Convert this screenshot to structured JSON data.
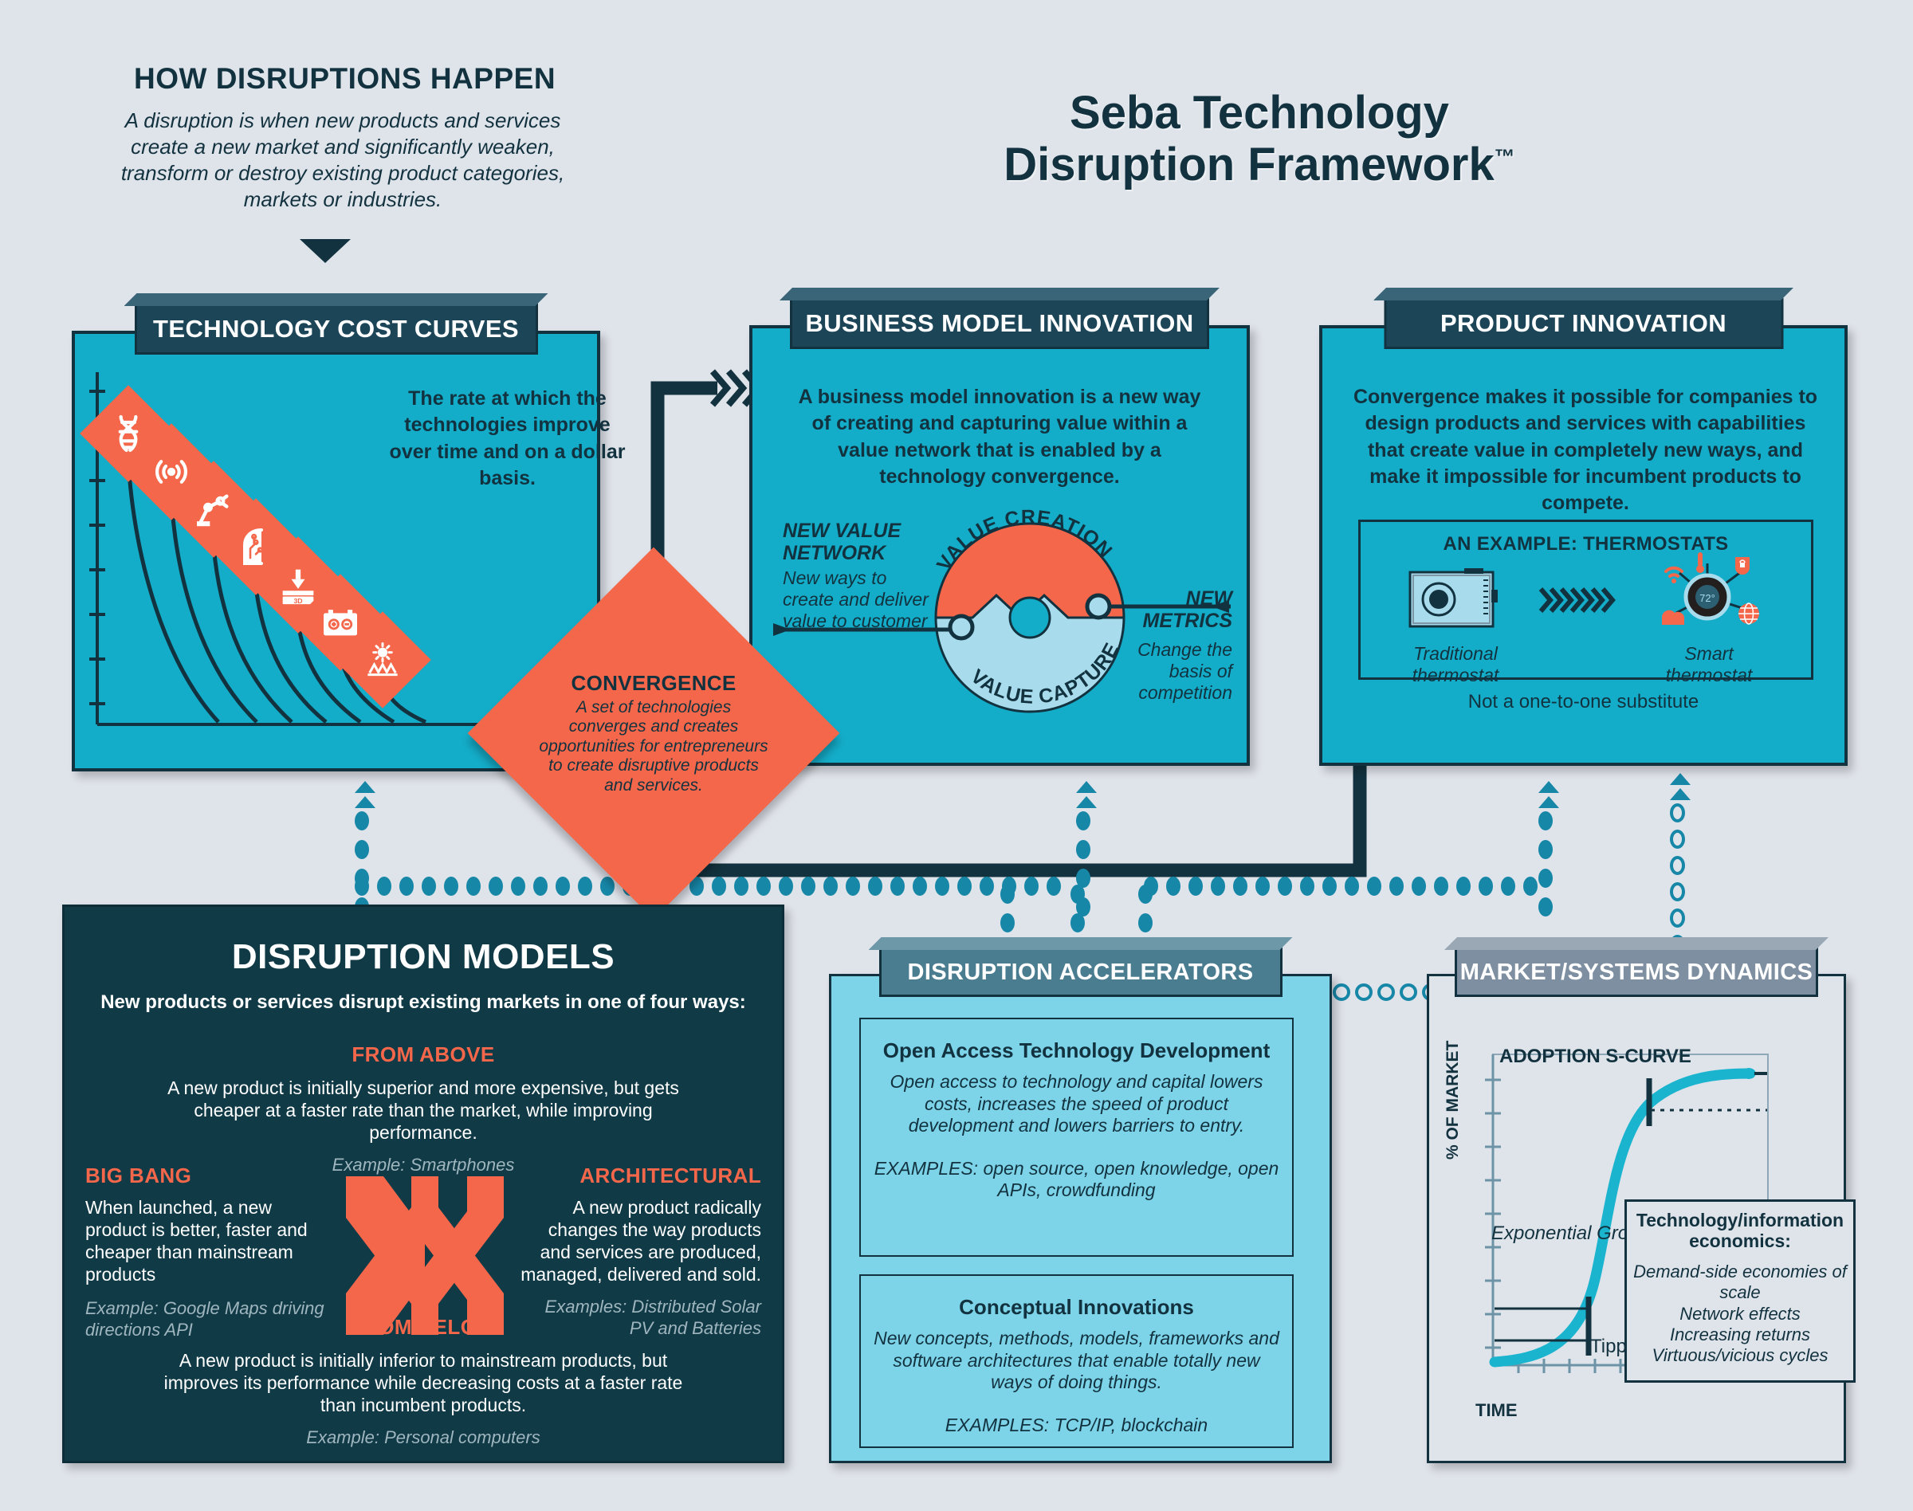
{
  "intro": {
    "title": "HOW DISRUPTIONS HAPPEN",
    "description": "A disruption is when new products and services create a new market and significantly weaken, transform or destroy existing product categories, markets or industries."
  },
  "main_title": {
    "line1": "Seba Technology",
    "line2": "Disruption Framework",
    "trademark": "™"
  },
  "tech_panel": {
    "tab": "TECHNOLOGY COST CURVES",
    "note": "The rate at which the technologies improve over time and on a dollar basis.",
    "icons": [
      "dna-icon",
      "wireless-sensor-icon",
      "robot-arm-icon",
      "ai-brain-icon",
      "3d-printer-icon",
      "battery-icon",
      "solar-panel-icon"
    ],
    "icon_3d_label": "3D"
  },
  "bmi_panel": {
    "tab": "BUSINESS MODEL INNOVATION",
    "note": "A business model innovation is a new way of creating and capturing value within a value network that is enabled by a technology convergence.",
    "left_head": "NEW VALUE NETWORK",
    "left_sub": "New ways to create and deliver value to customer",
    "right_head": "NEW METRICS",
    "right_sub": "Change the basis of competition",
    "wheel_top": "VALUE CREATION",
    "wheel_bottom": "VALUE CAPTURE"
  },
  "product_panel": {
    "tab": "PRODUCT INNOVATION",
    "note": "Convergence makes it possible for companies to design products and services with capabilities that create value in completely new ways, and make it impossible for incumbent products to compete.",
    "example_title": "AN EXAMPLE: THERMOSTATS",
    "traditional_label": "Traditional thermostat",
    "smart_label": "Smart thermostat",
    "smart_temp": "72°",
    "footnote": "Not a one-to-one substitute"
  },
  "convergence": {
    "title": "CONVERGENCE",
    "description": "A set of technologies converges and creates opportunities for entrepreneurs to create disruptive products and services."
  },
  "models_panel": {
    "title": "DISRUPTION MODELS",
    "subtitle": "New products or services  disrupt existing markets in one of four ways:",
    "items": [
      {
        "heading": "FROM ABOVE",
        "body": "A new product is initially superior and more expensive, but gets cheaper at a faster rate than the market, while improving performance.",
        "example": "Example: Smartphones"
      },
      {
        "heading": "BIG BANG",
        "body": "When launched, a new product is better, faster and cheaper than mainstream products",
        "example": "Example: Google Maps driving directions API"
      },
      {
        "heading": "ARCHITECTURAL",
        "body": "A new product radically changes the way products and services are produced, managed, delivered and sold.",
        "example": "Examples: Distributed Solar PV and Batteries"
      },
      {
        "heading": "FROM BELOW",
        "body": "A new product is initially inferior to mainstream products, but improves its performance while decreasing costs at a faster rate than incumbent products.",
        "example": "Example: Personal computers"
      }
    ]
  },
  "accelerators_panel": {
    "tab": "DISRUPTION ACCELERATORS",
    "cards": [
      {
        "heading": "Open Access Technology Development",
        "body": "Open access to technology and capital lowers costs, increases the speed of product development and lowers barriers to entry.",
        "examples": "EXAMPLES: open source, open knowledge, open APIs, crowdfunding"
      },
      {
        "heading": "Conceptual Innovations",
        "body": "New concepts, methods, models, frameworks and software architectures that enable totally new ways of doing things.",
        "examples": "EXAMPLES:  TCP/IP, blockchain"
      }
    ]
  },
  "market_panel": {
    "tab": "MARKET/SYSTEMS DYNAMICS",
    "curve_label": "ADOPTION S-CURVE",
    "exponential_label": "Exponential Growth",
    "tipping_label": "Tipping point",
    "economics_heading": "Technology/information economics:",
    "economics_list": "Demand-side economies of scale\nNetwork effects\nIncreasing returns\nVirtuous/vicious cycles"
  },
  "chart_data": {
    "type": "line",
    "title": "ADOPTION S-CURVE",
    "xlabel": "TIME",
    "ylabel": "% OF MARKET",
    "xlim": [
      0,
      10
    ],
    "ylim": [
      0,
      100
    ],
    "grid": false,
    "x": [
      0,
      1,
      2,
      3,
      3.5,
      4,
      4.5,
      5,
      5.5,
      6,
      7,
      8,
      9,
      10
    ],
    "y": [
      1,
      2,
      4,
      8,
      13,
      22,
      38,
      56,
      72,
      82,
      91,
      95,
      97,
      98
    ],
    "annotations": [
      {
        "label": "Exponential Growth",
        "x": 1.8,
        "y": 35
      },
      {
        "label": "Tipping point",
        "x": 4.2,
        "y": 12
      },
      {
        "label": "ADOPTION S-CURVE",
        "x": 1.2,
        "y": 93
      }
    ],
    "markers": [
      {
        "name": "tipping-point-marker",
        "x": 3.3,
        "y": 10
      },
      {
        "name": "saturation-marker",
        "x": 6.1,
        "y": 80
      }
    ]
  },
  "colors": {
    "background": "#dfe3ea",
    "cyan": "#14adc9",
    "dark_teal": "#12323f",
    "orange": "#f4674a",
    "light_blue": "#7dd3e8",
    "connector_blue": "#1787a8",
    "models_bg": "#113a47",
    "curve_blue": "#1bb4cf"
  }
}
